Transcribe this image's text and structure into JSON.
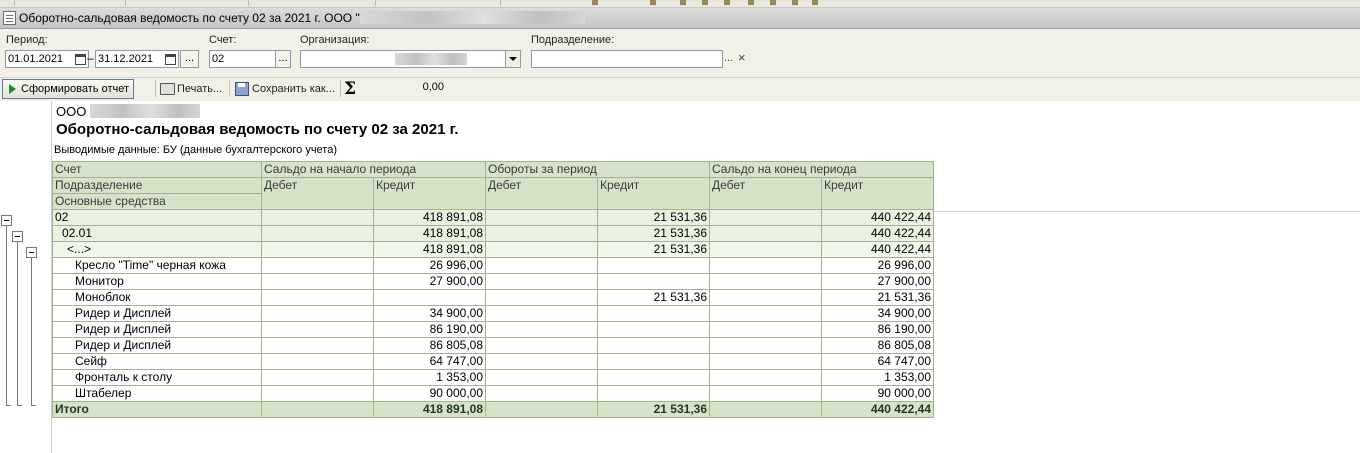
{
  "window": {
    "title_prefix": "Оборотно-сальдовая ведомость по счету 02 за 2021 г. ООО \""
  },
  "filters": {
    "period_label": "Период:",
    "period_from": "01.01.2021",
    "period_to": "31.12.2021",
    "account_label": "Счет:",
    "account_value": "02",
    "org_label": "Организация:",
    "org_value": "",
    "division_label": "Подразделение:",
    "division_value": "",
    "select_glyph": "...",
    "clear_glyph": "×"
  },
  "toolbar": {
    "form_report_label": "Сформировать отчет",
    "print_label": "Печать...",
    "save_as_label": "Сохранить как...",
    "sum_value": "0,00"
  },
  "report": {
    "org_prefix": "ООО",
    "title": "Оборотно-сальдовая ведомость по счету 02 за 2021 г.",
    "note": "Выводимые данные:  БУ (данные бухгалтерского учета)",
    "header": {
      "account": "Счет",
      "division": "Подразделение",
      "fixed_assets": "Основные средства",
      "opening_balance": "Сальдо на начало периода",
      "turnover": "Обороты за период",
      "closing_balance": "Сальдо на конец периода",
      "debit": "Дебет",
      "credit": "Кредит"
    },
    "rows": [
      {
        "name": "02",
        "open_debit": "",
        "open_credit": "418 891,08",
        "turn_debit": "",
        "turn_credit": "21 531,36",
        "close_debit": "",
        "close_credit": "440 422,44"
      },
      {
        "name": "02.01",
        "open_debit": "",
        "open_credit": "418 891,08",
        "turn_debit": "",
        "turn_credit": "21 531,36",
        "close_debit": "",
        "close_credit": "440 422,44"
      },
      {
        "name": "<...>",
        "open_debit": "",
        "open_credit": "418 891,08",
        "turn_debit": "",
        "turn_credit": "21 531,36",
        "close_debit": "",
        "close_credit": "440 422,44"
      },
      {
        "name": "Кресло \"Time\" черная кожа",
        "open_debit": "",
        "open_credit": "26 996,00",
        "turn_debit": "",
        "turn_credit": "",
        "close_debit": "",
        "close_credit": "26 996,00"
      },
      {
        "name": "Монитор",
        "open_debit": "",
        "open_credit": "27 900,00",
        "turn_debit": "",
        "turn_credit": "",
        "close_debit": "",
        "close_credit": "27 900,00"
      },
      {
        "name": "Моноблок",
        "open_debit": "",
        "open_credit": "",
        "turn_debit": "",
        "turn_credit": "21 531,36",
        "close_debit": "",
        "close_credit": "21 531,36"
      },
      {
        "name": "Ридер и Дисплей",
        "open_debit": "",
        "open_credit": "34 900,00",
        "turn_debit": "",
        "turn_credit": "",
        "close_debit": "",
        "close_credit": "34 900,00"
      },
      {
        "name": "Ридер и Дисплей",
        "open_debit": "",
        "open_credit": "86 190,00",
        "turn_debit": "",
        "turn_credit": "",
        "close_debit": "",
        "close_credit": "86 190,00"
      },
      {
        "name": "Ридер и Дисплей",
        "open_debit": "",
        "open_credit": "86 805,08",
        "turn_debit": "",
        "turn_credit": "",
        "close_debit": "",
        "close_credit": "86 805,08"
      },
      {
        "name": "Сейф",
        "open_debit": "",
        "open_credit": "64 747,00",
        "turn_debit": "",
        "turn_credit": "",
        "close_debit": "",
        "close_credit": "64 747,00"
      },
      {
        "name": "Фронталь к столу",
        "open_debit": "",
        "open_credit": "1 353,00",
        "turn_debit": "",
        "turn_credit": "",
        "close_debit": "",
        "close_credit": "1 353,00"
      },
      {
        "name": "Штабелер",
        "open_debit": "",
        "open_credit": "90 000,00",
        "turn_debit": "",
        "turn_credit": "",
        "close_debit": "",
        "close_credit": "90 000,00"
      }
    ],
    "total": {
      "name": "Итого",
      "open_debit": "",
      "open_credit": "418 891,08",
      "turn_debit": "",
      "turn_credit": "21 531,36",
      "close_debit": "",
      "close_credit": "440 422,44"
    }
  },
  "colors": {
    "header_green": "#d7e3c8",
    "grid_border": "#a3b38f",
    "run_arrow": "#1e8a2e"
  }
}
